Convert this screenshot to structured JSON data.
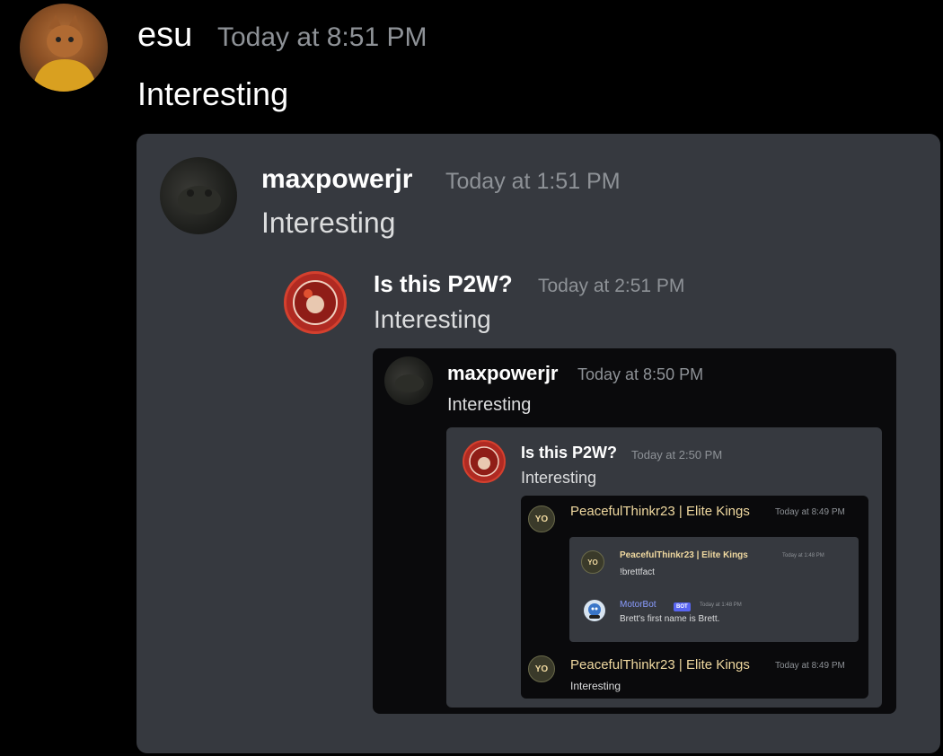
{
  "root_message": {
    "username": "esu",
    "timestamp": "Today at 8:51 PM",
    "content": "Interesting"
  },
  "quote_level_1": {
    "username": "maxpowerjr",
    "timestamp": "Today at 1:51 PM",
    "content": "Interesting"
  },
  "quote_level_2": {
    "username": "Is this P2W?",
    "timestamp": "Today at 2:51 PM",
    "content": "Interesting"
  },
  "quote_level_3": {
    "username": "maxpowerjr",
    "timestamp": "Today at 8:50 PM",
    "content": "Interesting"
  },
  "quote_level_4": {
    "username": "Is this P2W?",
    "timestamp": "Today at 2:50 PM",
    "content": "Interesting"
  },
  "quote_level_5": {
    "top": {
      "username": "PeacefulThinkr23 | Elite Kings",
      "timestamp": "Today at 8:49 PM"
    },
    "inner": {
      "user_message": {
        "username": "PeacefulThinkr23 | Elite Kings",
        "timestamp": "Today at 1:48 PM",
        "content": "!brettfact"
      },
      "bot_message": {
        "username": "MotorBot",
        "badge": "BOT",
        "timestamp": "Today at 1:48 PM",
        "content": "Brett's first name is Brett."
      }
    },
    "bottom": {
      "username": "PeacefulThinkr23 | Elite Kings",
      "timestamp": "Today at 8:49 PM",
      "content": "Interesting"
    },
    "avatar_text": "YO"
  },
  "colors": {
    "background": "#000000",
    "panel_gray": "#36393f",
    "panel_dark": "#111214",
    "embed_gray": "#3b3d44",
    "username_gold": "#f0d9a0",
    "bot_blurple": "#5865f2"
  }
}
